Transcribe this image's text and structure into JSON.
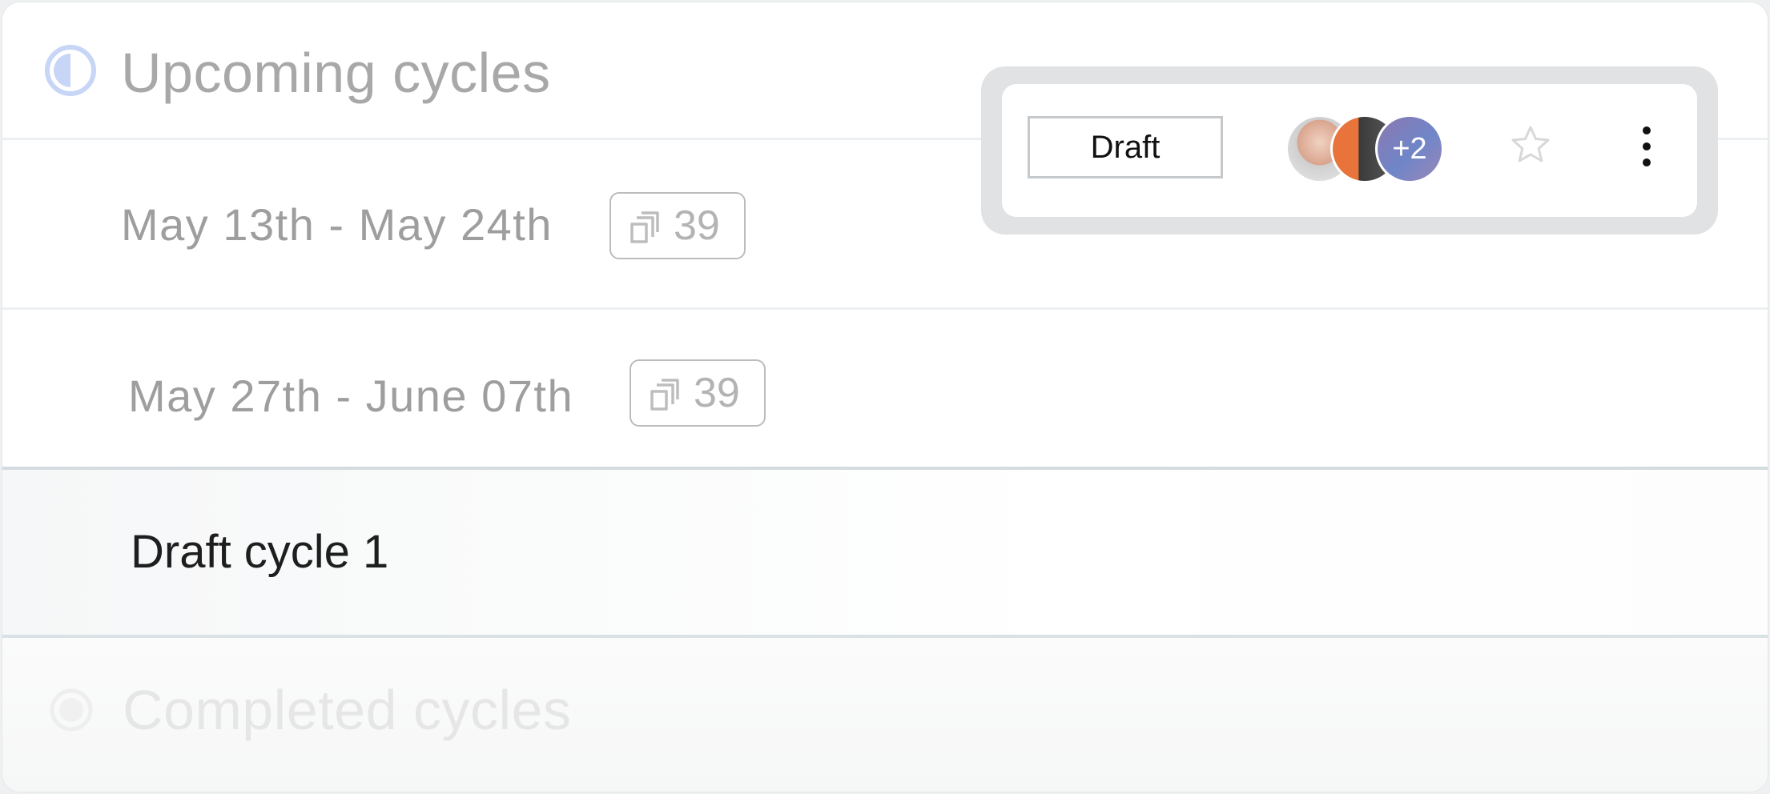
{
  "upcoming": {
    "title": "Upcoming cycles"
  },
  "rows": [
    {
      "date_range": "May 13th - May 24th",
      "issue_count": "39"
    },
    {
      "date_range": "May 27th - June 07th",
      "issue_count": "39"
    }
  ],
  "draft": {
    "title": "Draft cycle 1"
  },
  "completed": {
    "title": "Completed cycles"
  },
  "toolbar": {
    "status_label": "Draft",
    "extra_members": "+2",
    "star_icon": "star-icon",
    "more_icon": "more-vertical-icon"
  },
  "colors": {
    "accent": "#5b8def",
    "muted_text": "#9e9e9e"
  }
}
